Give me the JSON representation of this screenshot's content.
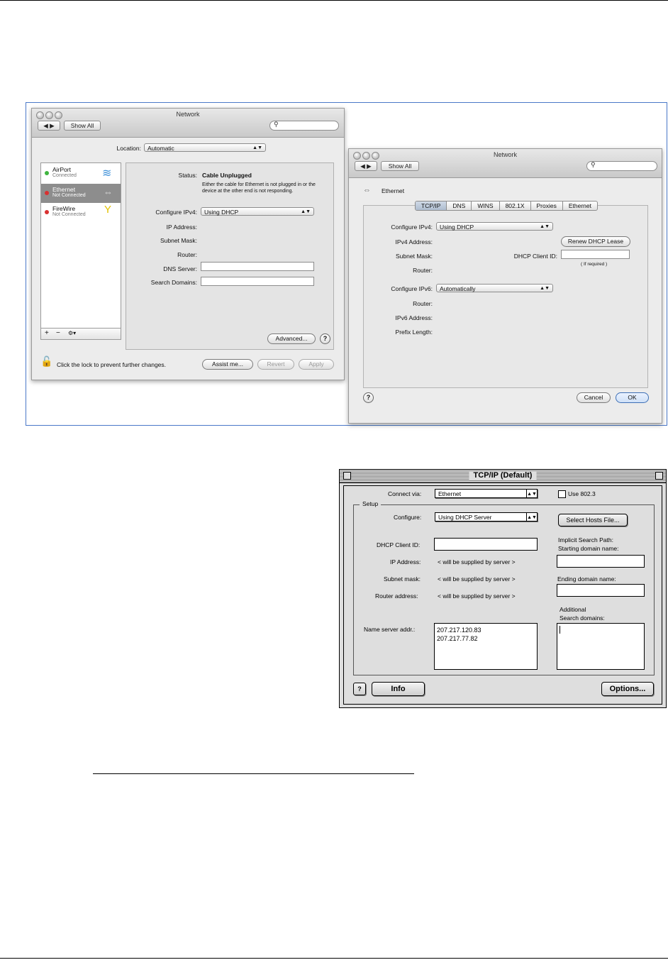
{
  "network_window": {
    "title": "Network",
    "show_all": "Show All",
    "location_label": "Location:",
    "location_value": "Automatic",
    "services": [
      {
        "name": "AirPort",
        "status": "Connected",
        "dot": "#3fb53f"
      },
      {
        "name": "Ethernet",
        "status": "Not Connected",
        "dot": "#d93030"
      },
      {
        "name": "FireWire",
        "status": "Not Connected",
        "dot": "#d93030"
      }
    ],
    "list_buttons": {
      "add": "+",
      "remove": "−",
      "action": "⚙▾"
    },
    "status_label": "Status:",
    "status_value": "Cable Unplugged",
    "status_detail": "Either the cable for Ethernet is not plugged in or the device at the other end is not responding.",
    "configure_ipv4_label": "Configure IPv4:",
    "configure_ipv4_value": "Using DHCP",
    "ip_address_label": "IP Address:",
    "subnet_mask_label": "Subnet Mask:",
    "router_label": "Router:",
    "dns_server_label": "DNS Server:",
    "search_domains_label": "Search Domains:",
    "advanced_button": "Advanced...",
    "help": "?",
    "lock_text": "Click the lock to prevent further changes.",
    "assist_button": "Assist me...",
    "revert_button": "Revert",
    "apply_button": "Apply"
  },
  "advanced_window": {
    "title": "Network",
    "show_all": "Show All",
    "service": "Ethernet",
    "tabs": [
      "TCP/IP",
      "DNS",
      "WINS",
      "802.1X",
      "Proxies",
      "Ethernet"
    ],
    "configure_ipv4_label": "Configure IPv4:",
    "configure_ipv4_value": "Using DHCP",
    "ipv4_address_label": "IPv4 Address:",
    "renew_button": "Renew DHCP Lease",
    "subnet_mask_label": "Subnet Mask:",
    "dhcp_client_id_label": "DHCP Client ID:",
    "if_required": "( If required )",
    "router_label": "Router:",
    "configure_ipv6_label": "Configure IPv6:",
    "configure_ipv6_value": "Automatically",
    "router6_label": "Router:",
    "ipv6_address_label": "IPv6 Address:",
    "prefix_length_label": "Prefix Length:",
    "help": "?",
    "cancel_button": "Cancel",
    "ok_button": "OK"
  },
  "classic_window": {
    "title": "TCP/IP (Default)",
    "connect_via_label": "Connect via:",
    "connect_via_value": "Ethernet",
    "use_8023": "Use 802.3",
    "setup_group": "Setup",
    "configure_label": "Configure:",
    "configure_value": "Using DHCP Server",
    "select_hosts_button": "Select Hosts File...",
    "implicit_search_path": "Implicit Search Path:",
    "starting_domain": "Starting domain name:",
    "dhcp_client_id_label": "DHCP Client ID:",
    "ip_address_label": "IP Address:",
    "ip_address_value": "< will be supplied by server >",
    "subnet_mask_label": "Subnet mask:",
    "subnet_mask_value": "< will be supplied by server >",
    "router_address_label": "Router address:",
    "router_address_value": "< will be supplied by server >",
    "ending_domain": "Ending domain name:",
    "additional": "Additional",
    "search_domains": "Search domains:",
    "name_server_label": "Name server addr.:",
    "name_servers": [
      "207.217.120.83",
      "207.217.77.82"
    ],
    "help": "?",
    "info_button": "Info",
    "options_button": "Options..."
  }
}
